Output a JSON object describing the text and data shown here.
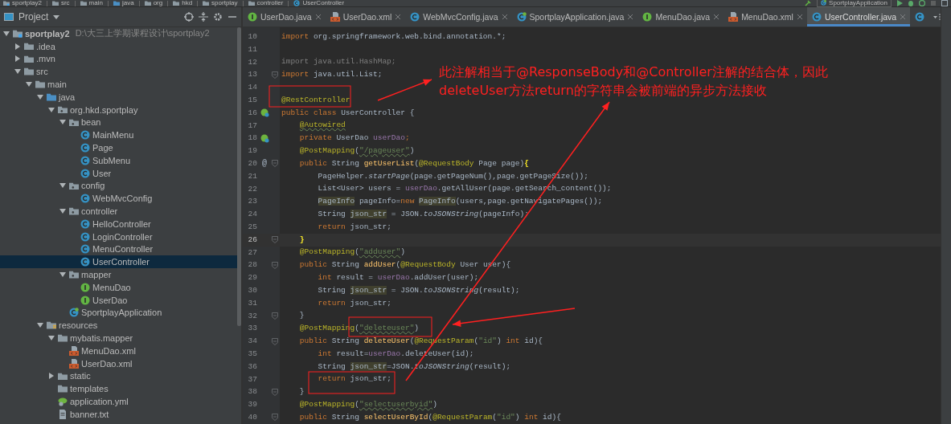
{
  "breadcrumbs": [
    {
      "label": "sportplay2",
      "kind": "module"
    },
    {
      "label": "src",
      "kind": "folder"
    },
    {
      "label": "main",
      "kind": "folder"
    },
    {
      "label": "java",
      "kind": "source"
    },
    {
      "label": "org",
      "kind": "folder"
    },
    {
      "label": "hkd",
      "kind": "folder"
    },
    {
      "label": "sportplay",
      "kind": "folder"
    },
    {
      "label": "controller",
      "kind": "folder"
    },
    {
      "label": "UserController",
      "kind": "class"
    }
  ],
  "run_config": {
    "label": "SportplayApplication"
  },
  "project_panel": {
    "title": "Project",
    "tree": [
      {
        "label": "sportplay2",
        "path": "D:\\大三上学期课程设计\\sportplay2",
        "kind": "module",
        "expanded": true,
        "selected": false,
        "children": [
          {
            "label": ".idea",
            "kind": "folder",
            "expanded": false,
            "selected": false
          },
          {
            "label": ".mvn",
            "kind": "folder",
            "expanded": false,
            "selected": false
          },
          {
            "label": "src",
            "kind": "folder",
            "expanded": true,
            "selected": false,
            "children": [
              {
                "label": "main",
                "kind": "folder",
                "expanded": true,
                "selected": false,
                "children": [
                  {
                    "label": "java",
                    "kind": "source",
                    "expanded": true,
                    "selected": false,
                    "children": [
                      {
                        "label": "org.hkd.sportplay",
                        "kind": "package",
                        "expanded": true,
                        "selected": false,
                        "children": [
                          {
                            "label": "bean",
                            "kind": "package",
                            "expanded": true,
                            "selected": false,
                            "children": [
                              {
                                "label": "MainMenu",
                                "kind": "class",
                                "selected": false
                              },
                              {
                                "label": "Page",
                                "kind": "class",
                                "selected": false
                              },
                              {
                                "label": "SubMenu",
                                "kind": "class",
                                "selected": false
                              },
                              {
                                "label": "User",
                                "kind": "class",
                                "selected": false
                              }
                            ]
                          },
                          {
                            "label": "config",
                            "kind": "package",
                            "expanded": true,
                            "selected": false,
                            "children": [
                              {
                                "label": "WebMvcConfig",
                                "kind": "class",
                                "selected": false
                              }
                            ]
                          },
                          {
                            "label": "controller",
                            "kind": "package",
                            "expanded": true,
                            "selected": false,
                            "children": [
                              {
                                "label": "HelloController",
                                "kind": "class",
                                "selected": false
                              },
                              {
                                "label": "LoginController",
                                "kind": "class",
                                "selected": false
                              },
                              {
                                "label": "MenuController",
                                "kind": "class",
                                "selected": false
                              },
                              {
                                "label": "UserController",
                                "kind": "class",
                                "selected": true
                              }
                            ]
                          },
                          {
                            "label": "mapper",
                            "kind": "package",
                            "expanded": true,
                            "selected": false,
                            "children": [
                              {
                                "label": "MenuDao",
                                "kind": "interface",
                                "selected": false
                              },
                              {
                                "label": "UserDao",
                                "kind": "interface",
                                "selected": false
                              }
                            ]
                          },
                          {
                            "label": "SportplayApplication",
                            "kind": "spring",
                            "selected": false
                          }
                        ]
                      }
                    ]
                  },
                  {
                    "label": "resources",
                    "kind": "resources",
                    "expanded": true,
                    "selected": false,
                    "children": [
                      {
                        "label": "mybatis.mapper",
                        "kind": "folder",
                        "expanded": true,
                        "selected": false,
                        "children": [
                          {
                            "label": "MenuDao.xml",
                            "kind": "xml",
                            "selected": false
                          },
                          {
                            "label": "UserDao.xml",
                            "kind": "xml",
                            "selected": false
                          }
                        ]
                      },
                      {
                        "label": "static",
                        "kind": "folder",
                        "expanded": false,
                        "selected": false
                      },
                      {
                        "label": "templates",
                        "kind": "folder",
                        "selected": false
                      },
                      {
                        "label": "application.yml",
                        "kind": "yml",
                        "selected": false
                      },
                      {
                        "label": "banner.txt",
                        "kind": "txt",
                        "selected": false
                      }
                    ]
                  }
                ]
              }
            ]
          }
        ]
      }
    ]
  },
  "tabs": [
    {
      "label": "UserDao.java",
      "kind": "interface",
      "selected": false
    },
    {
      "label": "UserDao.xml",
      "kind": "xml",
      "selected": false
    },
    {
      "label": "WebMvcConfig.java",
      "kind": "class",
      "selected": false
    },
    {
      "label": "SportplayApplication.java",
      "kind": "spring",
      "selected": false
    },
    {
      "label": "MenuDao.java",
      "kind": "interface",
      "selected": false
    },
    {
      "label": "MenuDao.xml",
      "kind": "xml",
      "selected": false
    },
    {
      "label": "UserController.java",
      "kind": "class",
      "selected": true
    }
  ],
  "editor": {
    "lines": [
      {
        "number": "10",
        "fold": false,
        "current": false,
        "tokens": [
          {
            "text": "import",
            "kind": "keyword"
          },
          {
            "text": " org.springframework.web.bind.annotation.*;",
            "kind": "plain"
          }
        ]
      },
      {
        "number": "11",
        "fold": false,
        "current": false
      },
      {
        "number": "12",
        "fold": false,
        "current": false,
        "tokens": [
          {
            "text": "import java.util.HashMap;",
            "kind": "unused"
          }
        ]
      },
      {
        "number": "13",
        "fold": true,
        "current": false,
        "tokens": [
          {
            "text": "import",
            "kind": "keyword"
          },
          {
            "text": " java.util.List;",
            "kind": "plain"
          }
        ]
      },
      {
        "number": "14",
        "fold": false,
        "current": false
      },
      {
        "number": "15",
        "fold": false,
        "current": false,
        "tokens": [
          {
            "text": "@RestController",
            "kind": "annotation"
          }
        ]
      },
      {
        "number": "16",
        "fold": false,
        "current": false,
        "gutter": {
          "kind": "bean"
        },
        "tokens": [
          {
            "text": "public class ",
            "kind": "keyword"
          },
          {
            "text": "UserController {",
            "kind": "plain"
          }
        ]
      },
      {
        "number": "17",
        "fold": false,
        "current": false,
        "tokens": [
          {
            "text": "    @Autowired",
            "kind": "annotation-squiggle"
          }
        ]
      },
      {
        "number": "18",
        "fold": false,
        "current": false,
        "gutter": {
          "kind": "bean"
        },
        "tokens": [
          {
            "text": "    private ",
            "kind": "keyword"
          },
          {
            "text": "UserDao ",
            "kind": "plain"
          },
          {
            "text": "userDao",
            "kind": "field"
          },
          {
            "text": ";",
            "kind": "keyword"
          }
        ]
      },
      {
        "number": "19",
        "fold": false,
        "current": false,
        "tokens": [
          {
            "text": "    @PostMapping",
            "kind": "annotation"
          },
          {
            "text": "(",
            "kind": "plain"
          },
          {
            "text": "\"/pageuser\"",
            "kind": "string-squiggle"
          },
          {
            "text": ")",
            "kind": "plain"
          }
        ]
      },
      {
        "number": "20",
        "fold": true,
        "current": false,
        "gutter_mark": "@",
        "tokens": [
          {
            "text": "    public ",
            "kind": "keyword"
          },
          {
            "text": "String ",
            "kind": "plain"
          },
          {
            "text": "getUserList",
            "kind": "method"
          },
          {
            "text": "(",
            "kind": "plain"
          },
          {
            "text": "@RequestBody ",
            "kind": "annotation"
          },
          {
            "text": "Page page)",
            "kind": "plain"
          },
          {
            "text": "{",
            "kind": "brace"
          }
        ]
      },
      {
        "number": "21",
        "fold": false,
        "current": false,
        "tokens": [
          {
            "text": "        PageHelper.",
            "kind": "plain"
          },
          {
            "text": "startPage",
            "kind": "italic"
          },
          {
            "text": "(page.getPageNum(),page.getPageSize());",
            "kind": "plain"
          }
        ]
      },
      {
        "number": "22",
        "fold": false,
        "current": false,
        "tokens": [
          {
            "text": "        List<User> users = ",
            "kind": "plain"
          },
          {
            "text": "userDao",
            "kind": "field"
          },
          {
            "text": ".getAllUser(page.getSearch_content());",
            "kind": "plain"
          }
        ]
      },
      {
        "number": "23",
        "fold": false,
        "current": false,
        "tokens": [
          {
            "text": "        PageInfo",
            "kind": "usage"
          },
          {
            "text": " pageInfo=",
            "kind": "plain"
          },
          {
            "text": "new ",
            "kind": "keyword"
          },
          {
            "text": "PageInfo",
            "kind": "usage"
          },
          {
            "text": "(users,page.getNavigatePages());",
            "kind": "plain"
          }
        ]
      },
      {
        "number": "24",
        "fold": false,
        "current": false,
        "tokens": [
          {
            "text": "        String ",
            "kind": "plain"
          },
          {
            "text": "json_str",
            "kind": "usage"
          },
          {
            "text": " = JSON.",
            "kind": "plain"
          },
          {
            "text": "toJSONString",
            "kind": "italic"
          },
          {
            "text": "(pageInfo);",
            "kind": "plain"
          }
        ]
      },
      {
        "number": "25",
        "fold": false,
        "current": false,
        "tokens": [
          {
            "text": "        return ",
            "kind": "keyword"
          },
          {
            "text": "json_str;",
            "kind": "plain"
          }
        ]
      },
      {
        "number": "26",
        "fold": true,
        "current": true,
        "tokens": [
          {
            "text": "    }",
            "kind": "brace"
          }
        ]
      },
      {
        "number": "27",
        "fold": false,
        "current": false,
        "tokens": [
          {
            "text": "    @PostMapping",
            "kind": "annotation"
          },
          {
            "text": "(",
            "kind": "plain"
          },
          {
            "text": "\"adduser\"",
            "kind": "string-squiggle"
          },
          {
            "text": ")",
            "kind": "plain"
          }
        ]
      },
      {
        "number": "28",
        "fold": true,
        "current": false,
        "tokens": [
          {
            "text": "    public ",
            "kind": "keyword"
          },
          {
            "text": "String ",
            "kind": "plain"
          },
          {
            "text": "addUser",
            "kind": "method"
          },
          {
            "text": "(",
            "kind": "plain"
          },
          {
            "text": "@RequestBody ",
            "kind": "annotation"
          },
          {
            "text": "User user){",
            "kind": "plain"
          }
        ]
      },
      {
        "number": "29",
        "fold": false,
        "current": false,
        "tokens": [
          {
            "text": "        int ",
            "kind": "keyword"
          },
          {
            "text": "result = ",
            "kind": "plain"
          },
          {
            "text": "userDao",
            "kind": "field"
          },
          {
            "text": ".addUser(user);",
            "kind": "plain"
          }
        ]
      },
      {
        "number": "30",
        "fold": false,
        "current": false,
        "tokens": [
          {
            "text": "        String ",
            "kind": "plain"
          },
          {
            "text": "json_str",
            "kind": "usage"
          },
          {
            "text": " = JSON.",
            "kind": "plain"
          },
          {
            "text": "toJSONString",
            "kind": "italic"
          },
          {
            "text": "(result);",
            "kind": "plain"
          }
        ]
      },
      {
        "number": "31",
        "fold": false,
        "current": false,
        "tokens": [
          {
            "text": "        return ",
            "kind": "keyword"
          },
          {
            "text": "json_str;",
            "kind": "plain"
          }
        ]
      },
      {
        "number": "32",
        "fold": true,
        "current": false,
        "tokens": [
          {
            "text": "    }",
            "kind": "plain"
          }
        ]
      },
      {
        "number": "33",
        "fold": false,
        "current": false,
        "tokens": [
          {
            "text": "    @PostMapping",
            "kind": "annotation"
          },
          {
            "text": "(",
            "kind": "plain"
          },
          {
            "text": "\"deleteuser\"",
            "kind": "string-squiggle"
          },
          {
            "text": ")",
            "kind": "plain"
          }
        ]
      },
      {
        "number": "34",
        "fold": true,
        "current": false,
        "tokens": [
          {
            "text": "    public ",
            "kind": "keyword"
          },
          {
            "text": "String ",
            "kind": "plain"
          },
          {
            "text": "deleteUser",
            "kind": "method"
          },
          {
            "text": "(",
            "kind": "plain"
          },
          {
            "text": "@RequestParam",
            "kind": "annotation"
          },
          {
            "text": "(",
            "kind": "plain"
          },
          {
            "text": "\"id\"",
            "kind": "string"
          },
          {
            "text": ") ",
            "kind": "plain"
          },
          {
            "text": "int ",
            "kind": "keyword"
          },
          {
            "text": "id){",
            "kind": "plain"
          }
        ]
      },
      {
        "number": "35",
        "fold": false,
        "current": false,
        "tokens": [
          {
            "text": "        int ",
            "kind": "keyword"
          },
          {
            "text": "result=",
            "kind": "plain"
          },
          {
            "text": "userDao",
            "kind": "field"
          },
          {
            "text": ".deleteUser(id);",
            "kind": "plain"
          }
        ]
      },
      {
        "number": "36",
        "fold": false,
        "current": false,
        "tokens": [
          {
            "text": "        String ",
            "kind": "plain"
          },
          {
            "text": "json_str",
            "kind": "usage"
          },
          {
            "text": "=JSON.",
            "kind": "plain"
          },
          {
            "text": "toJSONString",
            "kind": "italic"
          },
          {
            "text": "(result);",
            "kind": "plain"
          }
        ]
      },
      {
        "number": "37",
        "fold": false,
        "current": false,
        "tokens": [
          {
            "text": "        return ",
            "kind": "keyword"
          },
          {
            "text": "json_str;",
            "kind": "plain"
          }
        ]
      },
      {
        "number": "38",
        "fold": true,
        "current": false,
        "tokens": [
          {
            "text": "    }",
            "kind": "plain"
          }
        ]
      },
      {
        "number": "39",
        "fold": false,
        "current": false,
        "tokens": [
          {
            "text": "    @PostMapping",
            "kind": "annotation"
          },
          {
            "text": "(",
            "kind": "plain"
          },
          {
            "text": "\"selectuserbyid\"",
            "kind": "string-squiggle"
          },
          {
            "text": ")",
            "kind": "plain"
          }
        ]
      },
      {
        "number": "40",
        "fold": true,
        "current": false,
        "tokens": [
          {
            "text": "    public ",
            "kind": "keyword"
          },
          {
            "text": "String ",
            "kind": "plain"
          },
          {
            "text": "selectUserById",
            "kind": "method"
          },
          {
            "text": "(",
            "kind": "plain"
          },
          {
            "text": "@RequestParam",
            "kind": "annotation"
          },
          {
            "text": "(",
            "kind": "plain"
          },
          {
            "text": "\"id\"",
            "kind": "string"
          },
          {
            "text": ") ",
            "kind": "plain"
          },
          {
            "text": "int ",
            "kind": "keyword"
          },
          {
            "text": "id){",
            "kind": "plain"
          }
        ]
      }
    ]
  },
  "note": {
    "lines": [
      "此注解相当于@ResponseBody和@Controller注解的结合体，因此",
      "deleteUser方法return的字符串会被前端的异步方法接收"
    ]
  }
}
